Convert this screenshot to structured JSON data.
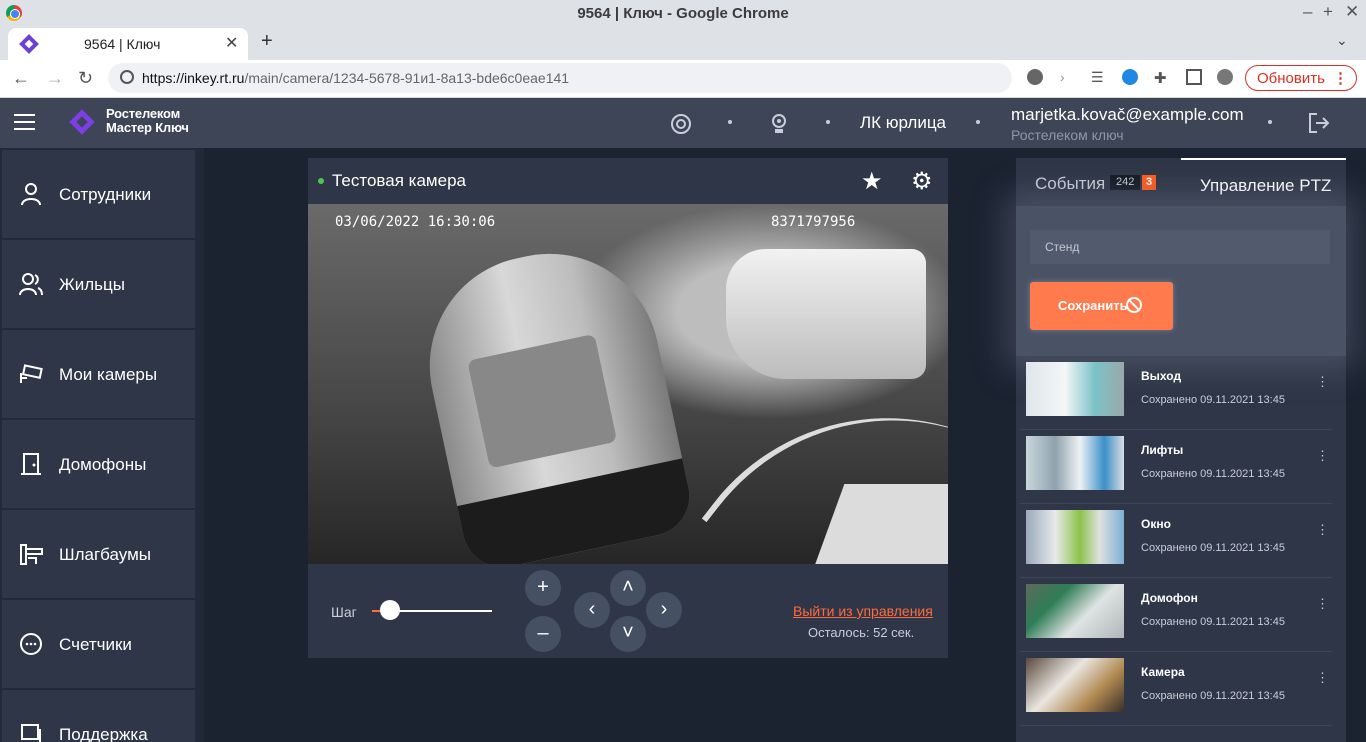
{
  "browser": {
    "window_title": "9564 | Ключ - Google Chrome",
    "tab_title": "9564 | Ключ",
    "url_domain": "https://inkey.rt.ru",
    "url_path": "/main/camera/1234-5678-91и1-8a13-bde6c0eae141",
    "update_label": "Обновить"
  },
  "header": {
    "logo_line1": "Ростелеком",
    "logo_line2": "Мастер Ключ",
    "account_type": "ЛК юрлица",
    "email": "marjetka.kovač@example.com",
    "org": "Ростелеком ключ"
  },
  "sidebar": {
    "items": [
      {
        "label": "Сотрудники",
        "icon": "person-icon"
      },
      {
        "label": "Жильцы",
        "icon": "people-icon"
      },
      {
        "label": "Мои камеры",
        "icon": "camera-icon"
      },
      {
        "label": "Домофоны",
        "icon": "door-icon"
      },
      {
        "label": "Шлагбаумы",
        "icon": "barrier-icon"
      },
      {
        "label": "Счетчики",
        "icon": "meter-icon"
      },
      {
        "label": "Поддержка",
        "icon": "chat-icon"
      }
    ]
  },
  "camera": {
    "title": "Тестовая камера",
    "osd_datetime": "03/06/2022 16:30:06",
    "osd_id": "8371797956",
    "step_label": "Шаг",
    "step_value": 0.15,
    "exit_label": "Выйти из управления",
    "remaining": "Осталось: 52 сек."
  },
  "right_panel": {
    "tab_events": "События",
    "events_count": "242",
    "events_new": "3",
    "tab_ptz": "Управление PTZ",
    "preset_placeholder": "Стенд",
    "save_label": "Сохранить",
    "presets": [
      {
        "name": "Выход",
        "saved": "Сохранено 09.11.2021 13:45"
      },
      {
        "name": "Лифты",
        "saved": "Сохранено 09.11.2021 13:45"
      },
      {
        "name": "Окно",
        "saved": "Сохранено 09.11.2021 13:45"
      },
      {
        "name": "Домофон",
        "saved": "Сохранено 09.11.2021 13:45"
      },
      {
        "name": "Камера",
        "saved": "Сохранено 09.11.2021 13:45"
      }
    ]
  },
  "colors": {
    "accent": "#ff6b3d",
    "header_bg": "#3d4556",
    "panel_bg": "#2e3647",
    "page_bg": "#1b2230"
  }
}
